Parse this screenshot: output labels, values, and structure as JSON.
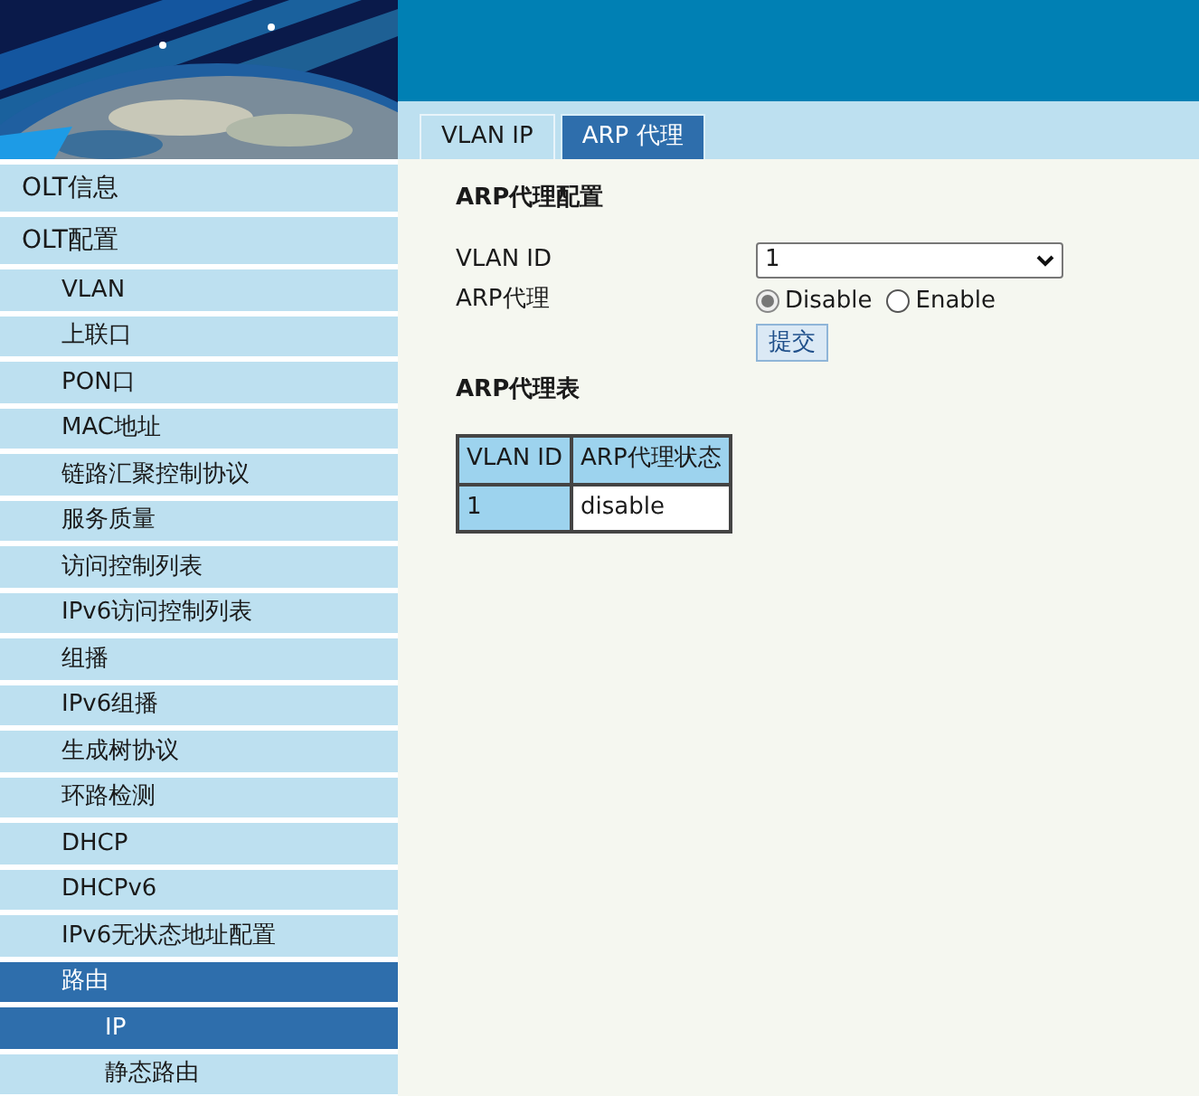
{
  "tabs": [
    {
      "label": "VLAN IP",
      "selected": false
    },
    {
      "label": "ARP 代理",
      "selected": true
    }
  ],
  "sidebar": {
    "items": [
      {
        "label": "OLT信息",
        "selected": false
      },
      {
        "label": "OLT配置",
        "selected": false,
        "children": [
          {
            "label": "VLAN",
            "selected": false
          },
          {
            "label": "上联口",
            "selected": false
          },
          {
            "label": "PON口",
            "selected": false
          },
          {
            "label": "MAC地址",
            "selected": false
          },
          {
            "label": "链路汇聚控制协议",
            "selected": false
          },
          {
            "label": "服务质量",
            "selected": false
          },
          {
            "label": "访问控制列表",
            "selected": false
          },
          {
            "label": "IPv6访问控制列表",
            "selected": false
          },
          {
            "label": "组播",
            "selected": false
          },
          {
            "label": "IPv6组播",
            "selected": false
          },
          {
            "label": "生成树协议",
            "selected": false
          },
          {
            "label": "环路检测",
            "selected": false
          },
          {
            "label": "DHCP",
            "selected": false
          },
          {
            "label": "DHCPv6",
            "selected": false
          },
          {
            "label": "IPv6无状态地址配置",
            "selected": false
          },
          {
            "label": "路由",
            "selected": true,
            "children": [
              {
                "label": "IP",
                "selected": true
              },
              {
                "label": "静态路由",
                "selected": false
              }
            ]
          }
        ]
      }
    ]
  },
  "config": {
    "title": "ARP代理配置",
    "vlan_id": {
      "label": "VLAN ID",
      "value": "1"
    },
    "arp_proxy": {
      "label": "ARP代理",
      "options": [
        {
          "label": "Disable",
          "selected": true
        },
        {
          "label": "Enable",
          "selected": false
        }
      ]
    },
    "submit": "提交"
  },
  "table": {
    "title": "ARP代理表",
    "columns": [
      "VLAN ID",
      "ARP代理状态"
    ],
    "rows": [
      [
        "1",
        "disable"
      ]
    ]
  }
}
